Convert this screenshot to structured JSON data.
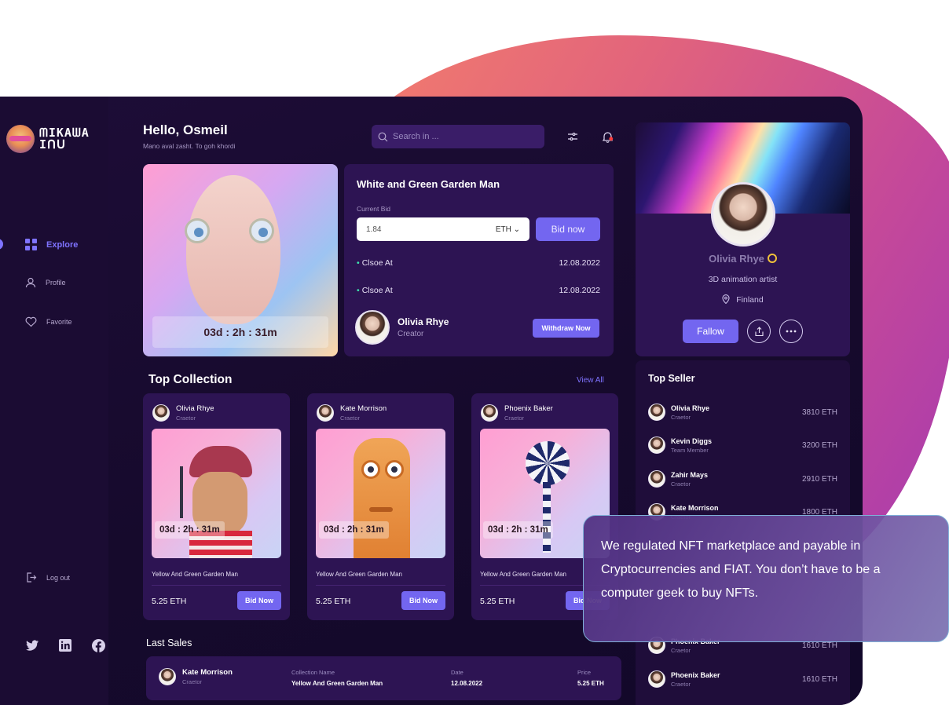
{
  "brand": {
    "logo_line1": "ᗰIKAᗯA",
    "logo_line2": "Iᑎᑌ"
  },
  "sidebar": {
    "items": [
      {
        "label": "Explore",
        "icon": "grid-icon"
      },
      {
        "label": "Profile",
        "icon": "user-icon"
      },
      {
        "label": "Favorite",
        "icon": "heart-icon"
      }
    ],
    "logout": "Log out",
    "socials": [
      "twitter-icon",
      "linkedin-icon",
      "facebook-icon"
    ]
  },
  "header": {
    "greeting": "Hello, Osmeil",
    "subtitle": "Mano aval zasht. To goh khordi",
    "search_placeholder": "Search in ..."
  },
  "hero": {
    "timer": "03d : 2h : 31m",
    "title": "White and Green Garden Man",
    "current_bid_label": "Current Bid",
    "bid_value": "1.84",
    "currency": "ETH",
    "bid_button": "Bid now",
    "close_rows": [
      {
        "label": "Clsoe At",
        "date": "12.08.2022"
      },
      {
        "label": "Clsoe At",
        "date": "12.08.2022"
      }
    ],
    "creator_name": "Olivia Rhye",
    "creator_role": "Creator",
    "withdraw_button": "Withdraw Now"
  },
  "collection": {
    "title": "Top Collection",
    "view_all": "View All",
    "cards": [
      {
        "creator": "Olivia Rhye",
        "role": "Craetor",
        "timer": "03d : 2h : 31m",
        "name": "Yellow And Green Garden Man",
        "price": "5.25  ETH",
        "button": "Bid Now"
      },
      {
        "creator": "Kate Morrison",
        "role": "Craetor",
        "timer": "03d : 2h : 31m",
        "name": "Yellow And Green Garden Man",
        "price": "5.25  ETH",
        "button": "Bid Now"
      },
      {
        "creator": "Phoenix Baker",
        "role": "Craetor",
        "timer": "03d : 2h : 31m",
        "name": "Yellow And Green Garden Man",
        "price": "5.25  ETH",
        "button": "Bid Now"
      }
    ]
  },
  "last_sales": {
    "title": "Last Sales",
    "row": {
      "name": "Kate Morrison",
      "role": "Craetor",
      "collection_header": "Collection Name",
      "collection_value": "Yellow And Green Garden Man",
      "date_header": "Date",
      "date_value": "12.08.2022",
      "price_header": "Price",
      "price_value": "5.25 ETH"
    }
  },
  "profile": {
    "name": "Olivia Rhye",
    "role": "3D animation artist",
    "location": "Finland",
    "follow_button": "Fallow"
  },
  "top_seller": {
    "title": "Top Seller",
    "rows": [
      {
        "name": "Olivia Rhye",
        "role": "Craetor",
        "eth": "3810 ETH"
      },
      {
        "name": "Kevin Diggs",
        "role": "Team Member",
        "eth": "3200 ETH"
      },
      {
        "name": "Zahir Mays",
        "role": "Craetor",
        "eth": "2910 ETH"
      },
      {
        "name": "Kate Morrison",
        "role": "Craetor",
        "eth": "1800 ETH"
      },
      {
        "name": "Phoenix Baker",
        "role": "Craetor",
        "eth": "1610 ETH"
      },
      {
        "name": "Phoenix Baker",
        "role": "Craetor",
        "eth": "1610 ETH"
      }
    ]
  },
  "overlay": {
    "text": "We regulated NFT marketplace and payable in Cryptocurrencies and FIAT. You don’t have to be a computer geek to buy NFTs."
  },
  "colors": {
    "accent": "#7366f0",
    "panel": "#2d1453",
    "background": "#160a2c",
    "success": "#3ee8b0"
  }
}
